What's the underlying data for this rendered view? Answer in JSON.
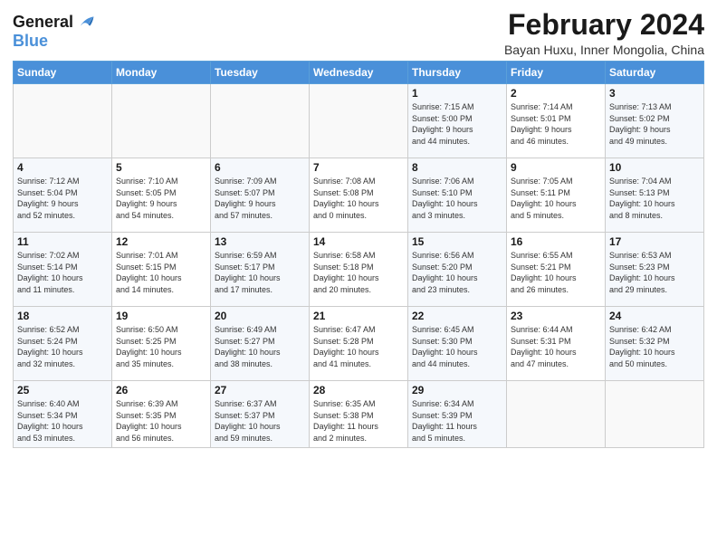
{
  "header": {
    "logo_line1": "General",
    "logo_line2": "Blue",
    "month": "February 2024",
    "location": "Bayan Huxu, Inner Mongolia, China"
  },
  "weekdays": [
    "Sunday",
    "Monday",
    "Tuesday",
    "Wednesday",
    "Thursday",
    "Friday",
    "Saturday"
  ],
  "weeks": [
    [
      {
        "day": "",
        "info": ""
      },
      {
        "day": "",
        "info": ""
      },
      {
        "day": "",
        "info": ""
      },
      {
        "day": "",
        "info": ""
      },
      {
        "day": "1",
        "info": "Sunrise: 7:15 AM\nSunset: 5:00 PM\nDaylight: 9 hours\nand 44 minutes."
      },
      {
        "day": "2",
        "info": "Sunrise: 7:14 AM\nSunset: 5:01 PM\nDaylight: 9 hours\nand 46 minutes."
      },
      {
        "day": "3",
        "info": "Sunrise: 7:13 AM\nSunset: 5:02 PM\nDaylight: 9 hours\nand 49 minutes."
      }
    ],
    [
      {
        "day": "4",
        "info": "Sunrise: 7:12 AM\nSunset: 5:04 PM\nDaylight: 9 hours\nand 52 minutes."
      },
      {
        "day": "5",
        "info": "Sunrise: 7:10 AM\nSunset: 5:05 PM\nDaylight: 9 hours\nand 54 minutes."
      },
      {
        "day": "6",
        "info": "Sunrise: 7:09 AM\nSunset: 5:07 PM\nDaylight: 9 hours\nand 57 minutes."
      },
      {
        "day": "7",
        "info": "Sunrise: 7:08 AM\nSunset: 5:08 PM\nDaylight: 10 hours\nand 0 minutes."
      },
      {
        "day": "8",
        "info": "Sunrise: 7:06 AM\nSunset: 5:10 PM\nDaylight: 10 hours\nand 3 minutes."
      },
      {
        "day": "9",
        "info": "Sunrise: 7:05 AM\nSunset: 5:11 PM\nDaylight: 10 hours\nand 5 minutes."
      },
      {
        "day": "10",
        "info": "Sunrise: 7:04 AM\nSunset: 5:13 PM\nDaylight: 10 hours\nand 8 minutes."
      }
    ],
    [
      {
        "day": "11",
        "info": "Sunrise: 7:02 AM\nSunset: 5:14 PM\nDaylight: 10 hours\nand 11 minutes."
      },
      {
        "day": "12",
        "info": "Sunrise: 7:01 AM\nSunset: 5:15 PM\nDaylight: 10 hours\nand 14 minutes."
      },
      {
        "day": "13",
        "info": "Sunrise: 6:59 AM\nSunset: 5:17 PM\nDaylight: 10 hours\nand 17 minutes."
      },
      {
        "day": "14",
        "info": "Sunrise: 6:58 AM\nSunset: 5:18 PM\nDaylight: 10 hours\nand 20 minutes."
      },
      {
        "day": "15",
        "info": "Sunrise: 6:56 AM\nSunset: 5:20 PM\nDaylight: 10 hours\nand 23 minutes."
      },
      {
        "day": "16",
        "info": "Sunrise: 6:55 AM\nSunset: 5:21 PM\nDaylight: 10 hours\nand 26 minutes."
      },
      {
        "day": "17",
        "info": "Sunrise: 6:53 AM\nSunset: 5:23 PM\nDaylight: 10 hours\nand 29 minutes."
      }
    ],
    [
      {
        "day": "18",
        "info": "Sunrise: 6:52 AM\nSunset: 5:24 PM\nDaylight: 10 hours\nand 32 minutes."
      },
      {
        "day": "19",
        "info": "Sunrise: 6:50 AM\nSunset: 5:25 PM\nDaylight: 10 hours\nand 35 minutes."
      },
      {
        "day": "20",
        "info": "Sunrise: 6:49 AM\nSunset: 5:27 PM\nDaylight: 10 hours\nand 38 minutes."
      },
      {
        "day": "21",
        "info": "Sunrise: 6:47 AM\nSunset: 5:28 PM\nDaylight: 10 hours\nand 41 minutes."
      },
      {
        "day": "22",
        "info": "Sunrise: 6:45 AM\nSunset: 5:30 PM\nDaylight: 10 hours\nand 44 minutes."
      },
      {
        "day": "23",
        "info": "Sunrise: 6:44 AM\nSunset: 5:31 PM\nDaylight: 10 hours\nand 47 minutes."
      },
      {
        "day": "24",
        "info": "Sunrise: 6:42 AM\nSunset: 5:32 PM\nDaylight: 10 hours\nand 50 minutes."
      }
    ],
    [
      {
        "day": "25",
        "info": "Sunrise: 6:40 AM\nSunset: 5:34 PM\nDaylight: 10 hours\nand 53 minutes."
      },
      {
        "day": "26",
        "info": "Sunrise: 6:39 AM\nSunset: 5:35 PM\nDaylight: 10 hours\nand 56 minutes."
      },
      {
        "day": "27",
        "info": "Sunrise: 6:37 AM\nSunset: 5:37 PM\nDaylight: 10 hours\nand 59 minutes."
      },
      {
        "day": "28",
        "info": "Sunrise: 6:35 AM\nSunset: 5:38 PM\nDaylight: 11 hours\nand 2 minutes."
      },
      {
        "day": "29",
        "info": "Sunrise: 6:34 AM\nSunset: 5:39 PM\nDaylight: 11 hours\nand 5 minutes."
      },
      {
        "day": "",
        "info": ""
      },
      {
        "day": "",
        "info": ""
      }
    ]
  ]
}
